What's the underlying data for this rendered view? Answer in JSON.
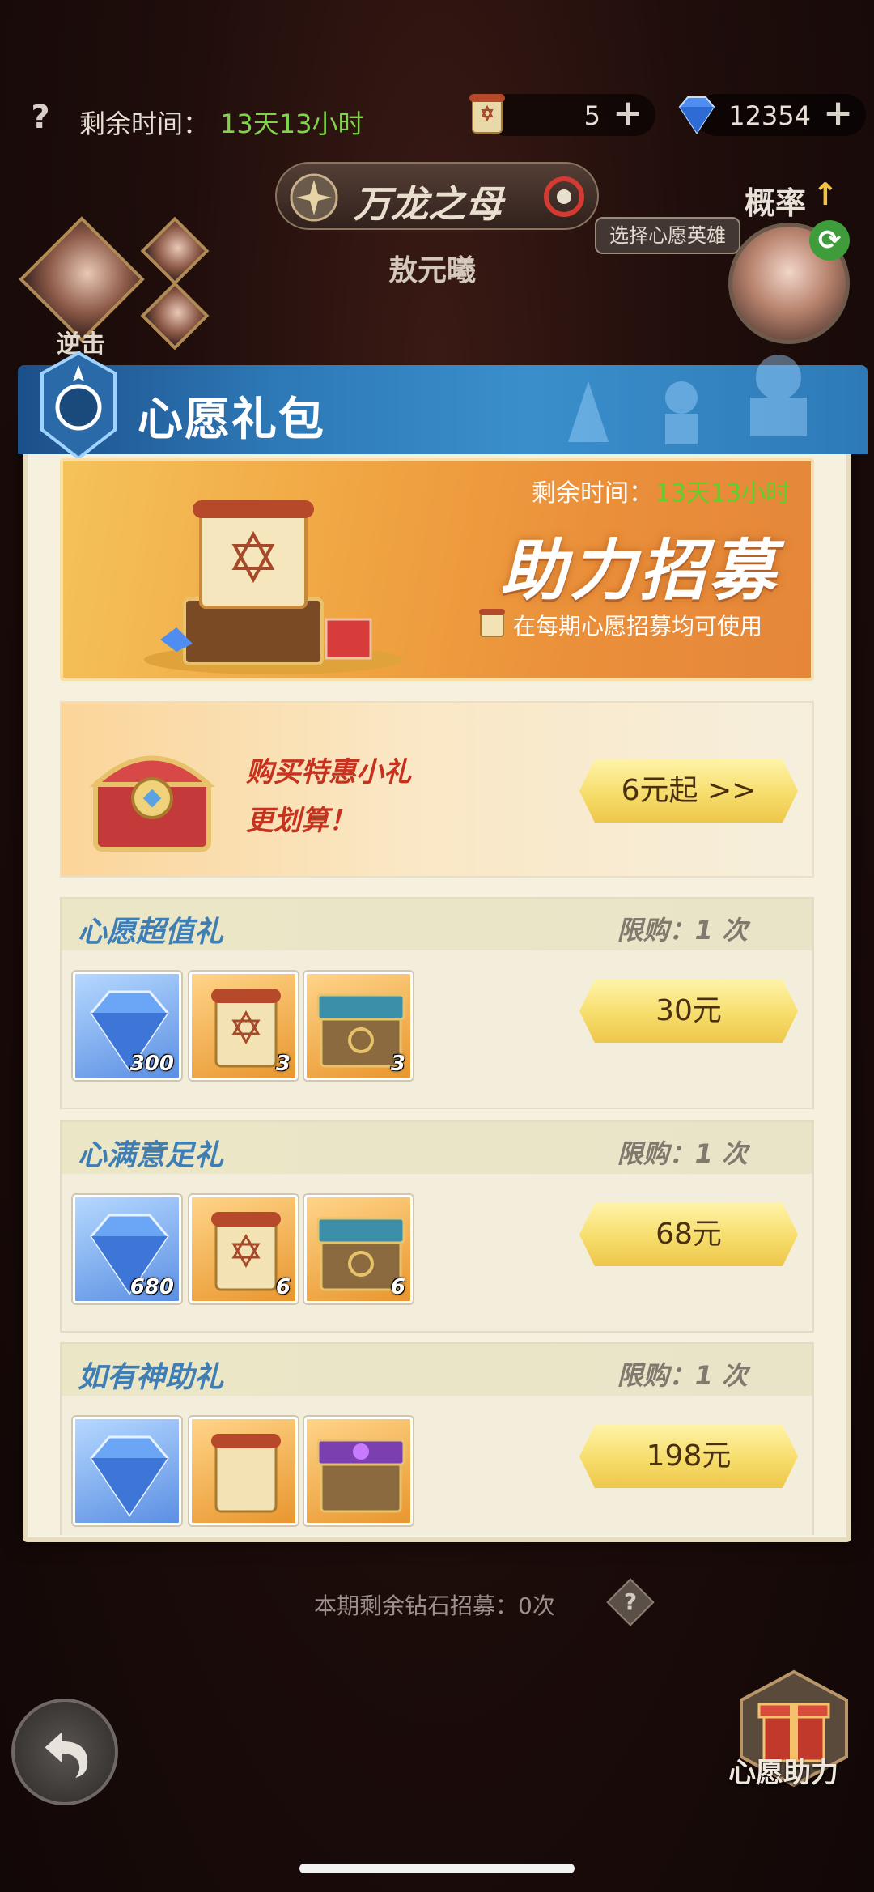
{
  "hud": {
    "help": "?",
    "time_label": "剩余时间：",
    "time_value": "13天13小时",
    "scroll_count": "5",
    "gem_count": "12354",
    "plus": "+"
  },
  "header": {
    "title": "万龙之母",
    "hero_name": "敖元曦",
    "probability_label": "概率",
    "probability_arrow": "↑",
    "select_hero": "选择心愿英雄",
    "counter_label": "逆击"
  },
  "popup": {
    "title": "心愿礼包",
    "banner": {
      "time_label": "剩余时间：",
      "time_value": "13天13小时",
      "title": "助力招募",
      "note": "在每期心愿招募均可使用"
    },
    "deal": {
      "line1": "购买特惠小礼",
      "line2": "更划算！",
      "price": "6元起 >>"
    },
    "gifts": [
      {
        "name": "心愿超值礼",
        "limit": "限购：1 次",
        "items": [
          {
            "icon": "diamond-icon",
            "count": "300"
          },
          {
            "icon": "scroll-icon",
            "count": "3"
          },
          {
            "icon": "chest-icon",
            "count": "3"
          }
        ],
        "price": "30元"
      },
      {
        "name": "心满意足礼",
        "limit": "限购：1 次",
        "items": [
          {
            "icon": "diamond-icon",
            "count": "680"
          },
          {
            "icon": "scroll-icon",
            "count": "6"
          },
          {
            "icon": "chest-icon",
            "count": "6"
          }
        ],
        "price": "68元"
      },
      {
        "name": "如有神助礼",
        "limit": "限购：1 次",
        "items": [
          {
            "icon": "diamond-icon",
            "count": ""
          },
          {
            "icon": "scroll-icon",
            "count": ""
          },
          {
            "icon": "purple-chest-icon",
            "count": ""
          }
        ],
        "price": "198元"
      }
    ]
  },
  "footer": {
    "remain_note": "本期剩余钻石招募：0次",
    "help": "?",
    "wish_help_label": "心愿助力"
  },
  "colors": {
    "accent_blue": "#2d78b6",
    "time_green": "#7fd44a",
    "price_gold": "#f6dd6b",
    "deal_red": "#c7321f"
  }
}
